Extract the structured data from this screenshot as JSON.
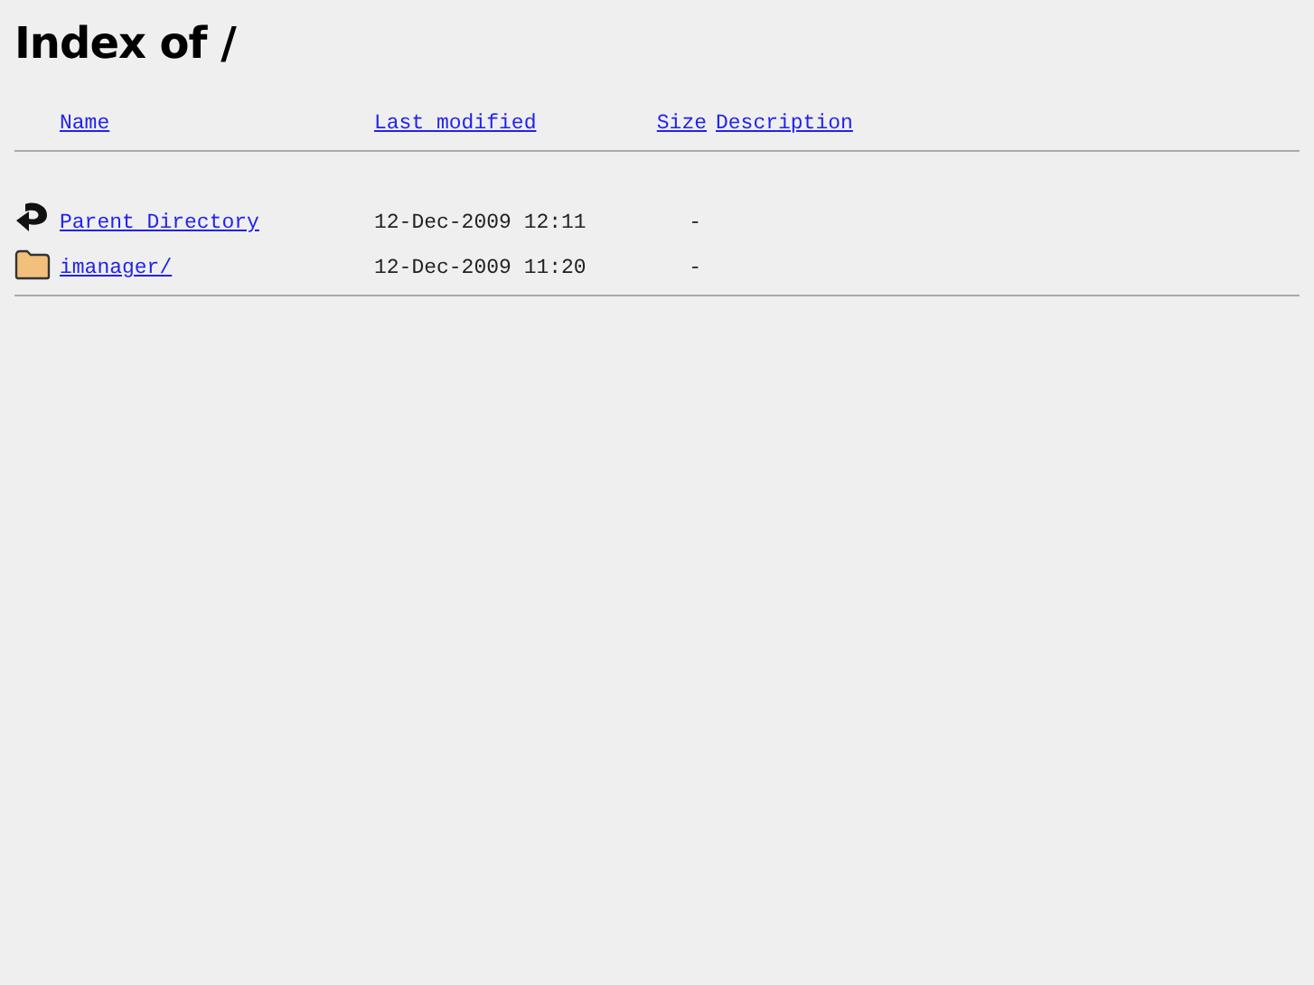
{
  "title": "Index of /",
  "columns": [
    "Name",
    "Last modified",
    "Size",
    "Description"
  ],
  "rows": [
    {
      "kind": "parent",
      "name": "Parent Directory",
      "modified": "12-Dec-2009 12:11",
      "size": "-"
    },
    {
      "kind": "folder",
      "name": "imanager/",
      "modified": "12-Dec-2009 11:20",
      "size": "-"
    }
  ]
}
